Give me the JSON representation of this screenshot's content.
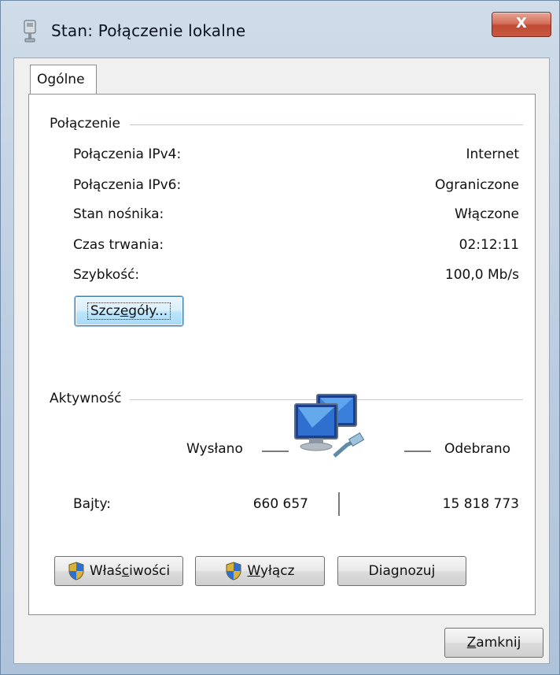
{
  "window": {
    "title": "Stan: Połączenie lokalne",
    "close_glyph": "X"
  },
  "tabs": [
    {
      "label": "Ogólne",
      "active": true
    }
  ],
  "connection": {
    "group_title": "Połączenie",
    "rows": [
      {
        "label": "Połączenia IPv4:",
        "value": "Internet"
      },
      {
        "label": "Połączenia IPv6:",
        "value": "Ograniczone"
      },
      {
        "label": "Stan nośnika:",
        "value": "Włączone"
      },
      {
        "label": "Czas trwania:",
        "value": "02:12:11"
      },
      {
        "label": "Szybkość:",
        "value": "100,0 Mb/s"
      }
    ],
    "details_button": {
      "prefix": "Szcz",
      "accel": "e",
      "suffix": "góły..."
    }
  },
  "activity": {
    "group_title": "Aktywność",
    "sent_label": "Wysłano",
    "received_label": "Odebrano",
    "bytes_label": "Bajty:",
    "bytes_sent": "660 657",
    "bytes_received": "15 818 773",
    "icon": "network-computers-icon"
  },
  "buttons": {
    "properties": {
      "prefix": "Właś",
      "accel": "c",
      "suffix": "iwości",
      "icon": "uac-shield-icon"
    },
    "disable": {
      "prefix": "",
      "accel": "W",
      "suffix": "yłącz",
      "icon": "uac-shield-icon"
    },
    "diagnose": {
      "prefix": "Dia",
      "accel": "g",
      "suffix": "nozuj"
    },
    "close": {
      "prefix": "",
      "accel": "Z",
      "suffix": "amknij"
    }
  },
  "colors": {
    "close_button": "#c75a40",
    "focus_border": "#3c7fb1",
    "window_frame": "#b9cbe0"
  }
}
